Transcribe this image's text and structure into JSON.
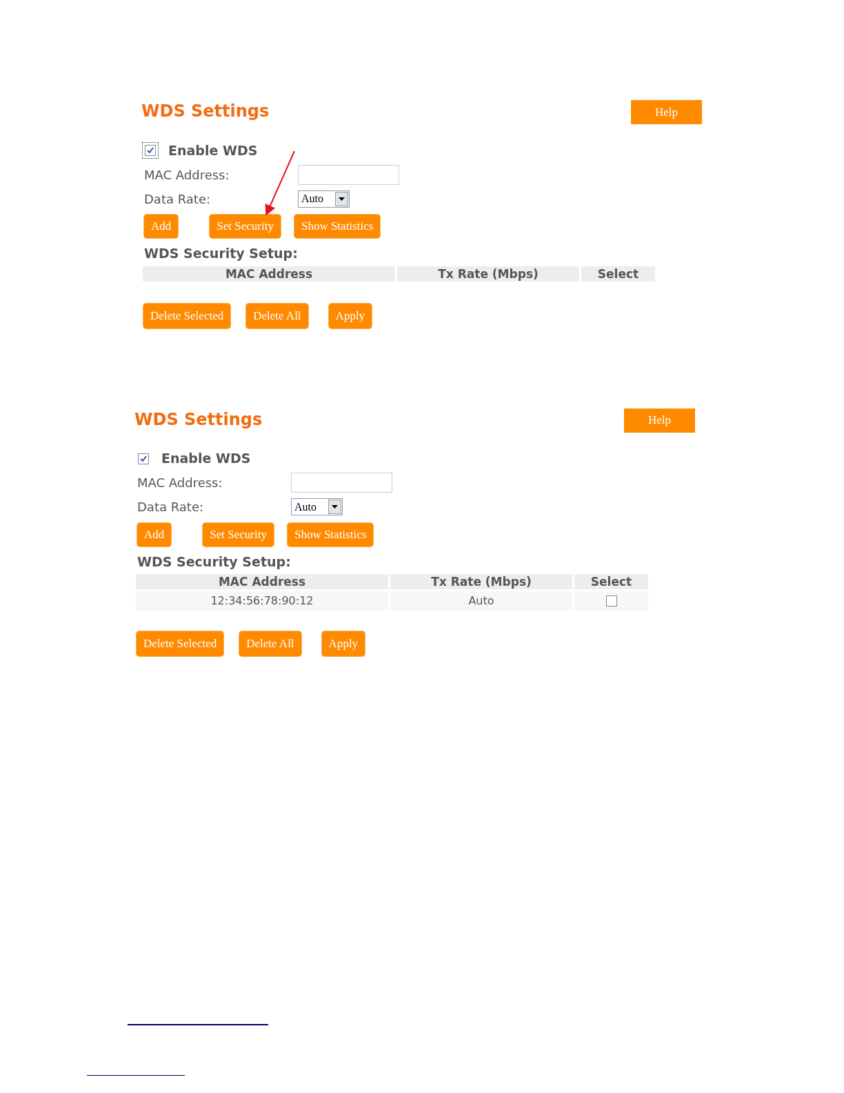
{
  "panels": [
    {
      "title": "WDS Settings",
      "help_button": "Help",
      "pointer_arrow": true,
      "enable": {
        "label": "Enable WDS",
        "checked": true,
        "focused": true
      },
      "mac_field": {
        "label": "MAC Address:"
      },
      "data_rate": {
        "label": "Data Rate:",
        "value": "Auto"
      },
      "action_buttons": [
        "Add",
        "Set Security",
        "Show Statistics"
      ],
      "section_title": "WDS Security Setup:",
      "table": {
        "columns": [
          "MAC Address",
          "Tx Rate (Mbps)",
          "Select"
        ]
      },
      "bottom_buttons": [
        "Delete Selected",
        "Delete All",
        "Apply"
      ]
    },
    {
      "title": "WDS Settings",
      "help_button": "Help",
      "enable": {
        "label": "Enable WDS",
        "checked": true,
        "focused": false
      },
      "mac_field": {
        "label": "MAC Address:"
      },
      "data_rate": {
        "label": "Data Rate:",
        "value": "Auto"
      },
      "action_buttons": [
        "Add",
        "Set Security",
        "Show Statistics"
      ],
      "section_title": "WDS Security Setup:",
      "table": {
        "columns": [
          "MAC Address",
          "Tx Rate (Mbps)",
          "Select"
        ],
        "rows": [
          {
            "mac": "12:34:56:78:90:12",
            "rate": "Auto",
            "selected": false
          }
        ]
      },
      "bottom_buttons": [
        "Delete Selected",
        "Delete All",
        "Apply"
      ]
    }
  ]
}
